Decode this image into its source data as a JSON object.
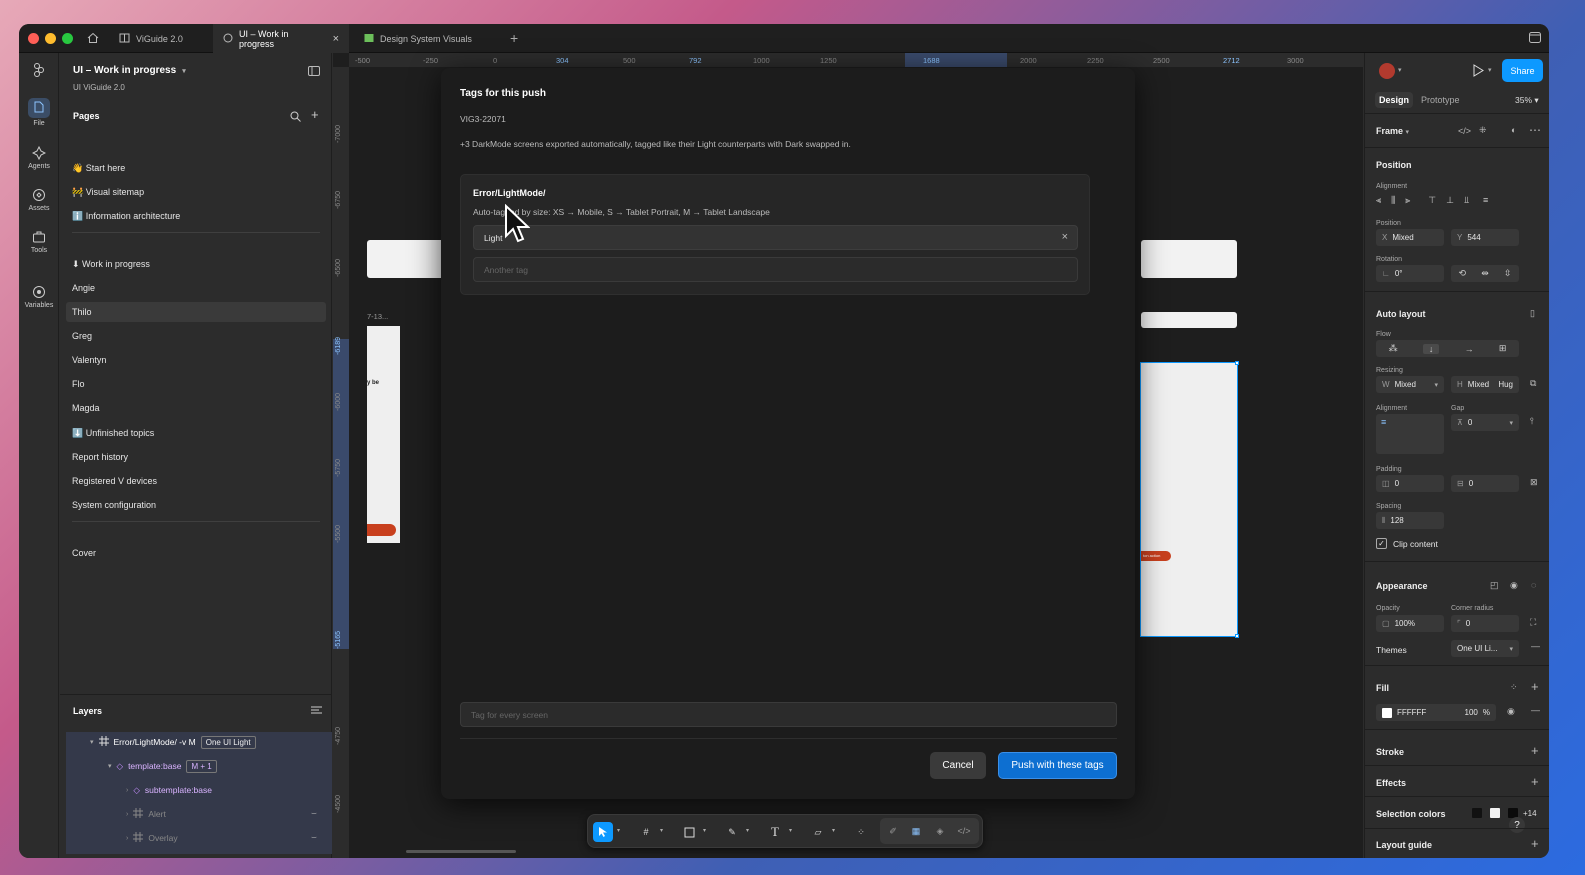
{
  "tabs": [
    {
      "label": "ViGuide 2.0"
    },
    {
      "label": "UI – Work in progress"
    },
    {
      "label": "Design System Visuals"
    }
  ],
  "rail": [
    {
      "label": "File",
      "icon": "file-icon"
    },
    {
      "label": "Agents",
      "icon": "agents-icon"
    },
    {
      "label": "Assets",
      "icon": "assets-icon"
    },
    {
      "label": "Tools",
      "icon": "tools-icon"
    },
    {
      "label": "Variables",
      "icon": "variables-icon"
    }
  ],
  "file": {
    "title": "UI – Work in progress",
    "subtitle": "UI ViGuide 2.0"
  },
  "pages": {
    "heading": "Pages",
    "items": [
      {
        "label": "👋 Start here"
      },
      {
        "label": "🚧 Visual sitemap"
      },
      {
        "label": "ℹ️ Information architecture"
      },
      {
        "label": "⬇ Work in progress"
      },
      {
        "label": "Angie"
      },
      {
        "label": "Thilo"
      },
      {
        "label": "Greg"
      },
      {
        "label": "Valentyn"
      },
      {
        "label": "Flo"
      },
      {
        "label": "Magda"
      },
      {
        "label": "⬇️ Unfinished topics"
      },
      {
        "label": "Report history"
      },
      {
        "label": "Registered V devices"
      },
      {
        "label": "System configuration"
      },
      {
        "label": "Cover"
      }
    ]
  },
  "layers": {
    "heading": "Layers",
    "items": [
      {
        "label": "Error/LightMode/ -v M",
        "badge": "One UI Light"
      },
      {
        "label": "template:base",
        "badge": "M + 1"
      },
      {
        "label": "subtemplate:base",
        "badge": ""
      },
      {
        "label": "Alert",
        "badge": ""
      },
      {
        "label": "Overlay",
        "badge": ""
      }
    ]
  },
  "ruler": {
    "top": [
      "-500",
      "-250",
      "0",
      "304",
      "500",
      "792",
      "1000",
      "1250",
      "1688",
      "2000",
      "2250",
      "2500",
      "2712",
      "3000"
    ],
    "left": [
      "-7000",
      "-6750",
      "-6500",
      "-6189",
      "-6000",
      "-5750",
      "-5500",
      "-5165",
      "-4750",
      "-4500"
    ]
  },
  "canvas": {
    "frame_label": "7-13...",
    "frame_text": "y be",
    "frame_button": "ton action"
  },
  "dialog": {
    "title": "Tags for this push",
    "ticket": "VIG3-22071",
    "note": "+3 DarkMode screens exported automatically, tagged like their Light counterparts with Dark swapped in.",
    "card_title": "Error/LightMode/",
    "card_sub": "Auto-tagged by size: XS → Mobile, S → Tablet Portrait, M → Tablet Landscape",
    "tag_value": "Light",
    "another_placeholder": "Another tag",
    "every_placeholder": "Tag for every screen",
    "cancel": "Cancel",
    "push": "Push with these tags"
  },
  "right": {
    "tab_design": "Design",
    "tab_prototype": "Prototype",
    "zoom": "35%",
    "share": "Share",
    "frame": "Frame",
    "position": "Position",
    "alignment": "Alignment",
    "pos_label": "Position",
    "x_label": "X",
    "x_value": "Mixed",
    "y_label": "Y",
    "y_value": "544",
    "rotation": "Rotation",
    "rotation_value": "0°",
    "autolayout": "Auto layout",
    "flow": "Flow",
    "resizing": "Resizing",
    "w_label": "W",
    "w_value": "Mixed",
    "h_label": "H",
    "h_value": "Mixed",
    "h_mode": "Hug",
    "al_alignment": "Alignment",
    "gap": "Gap",
    "gap_value": "0",
    "padding": "Padding",
    "pad_h": "0",
    "pad_v": "0",
    "spacing": "Spacing",
    "spacing_value": "128",
    "clip": "Clip content",
    "appearance": "Appearance",
    "opacity": "Opacity",
    "opacity_value": "100%",
    "corner": "Corner radius",
    "corner_value": "0",
    "themes": "Themes",
    "themes_value": "One UI Li...",
    "fill": "Fill",
    "fill_hex": "FFFFFF",
    "fill_opacity": "100",
    "fill_pct": "%",
    "stroke": "Stroke",
    "effects": "Effects",
    "selection_colors": "Selection colors",
    "sel_more": "+14",
    "layout_guide": "Layout guide"
  },
  "colors": {
    "accent": "#0d99ff",
    "bg": "#2c2c2c",
    "dialog": "#1c1c1c"
  }
}
